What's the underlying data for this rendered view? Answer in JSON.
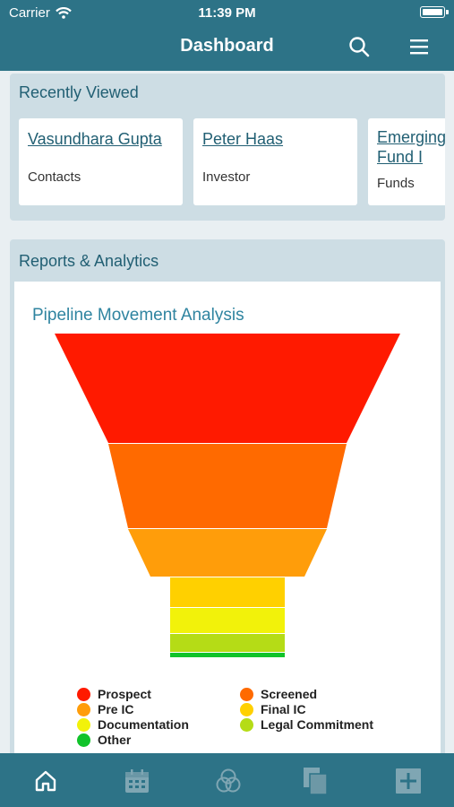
{
  "status": {
    "carrier": "Carrier",
    "time": "11:39 PM"
  },
  "header": {
    "title": "Dashboard"
  },
  "recently_viewed": {
    "title": "Recently Viewed",
    "items": [
      {
        "name": "Vasundhara Gupta",
        "type": "Contacts"
      },
      {
        "name": "Peter Haas",
        "type": "Investor"
      },
      {
        "name": "Emerging Fund I",
        "name_line1": "Emerging",
        "name_line2": "Fund I",
        "type": "Funds"
      }
    ]
  },
  "reports": {
    "title": "Reports & Analytics"
  },
  "chart_data": {
    "type": "funnel",
    "title": "Pipeline Movement Analysis",
    "stages": [
      {
        "name": "Prospect",
        "color": "#ff1a00"
      },
      {
        "name": "Screened",
        "color": "#ff6a00"
      },
      {
        "name": "Pre IC",
        "color": "#ff9d0a"
      },
      {
        "name": "Final IC",
        "color": "#ffd000"
      },
      {
        "name": "Documentation",
        "color": "#f2f20a"
      },
      {
        "name": "Legal Commitment",
        "color": "#b5dc16"
      },
      {
        "name": "Other",
        "color": "#11c32a"
      }
    ],
    "legend_position": "bottom"
  },
  "tabs": [
    {
      "name": "home-icon"
    },
    {
      "name": "calendar-icon"
    },
    {
      "name": "triple-circle-icon"
    },
    {
      "name": "documents-icon"
    },
    {
      "name": "add-icon"
    }
  ]
}
